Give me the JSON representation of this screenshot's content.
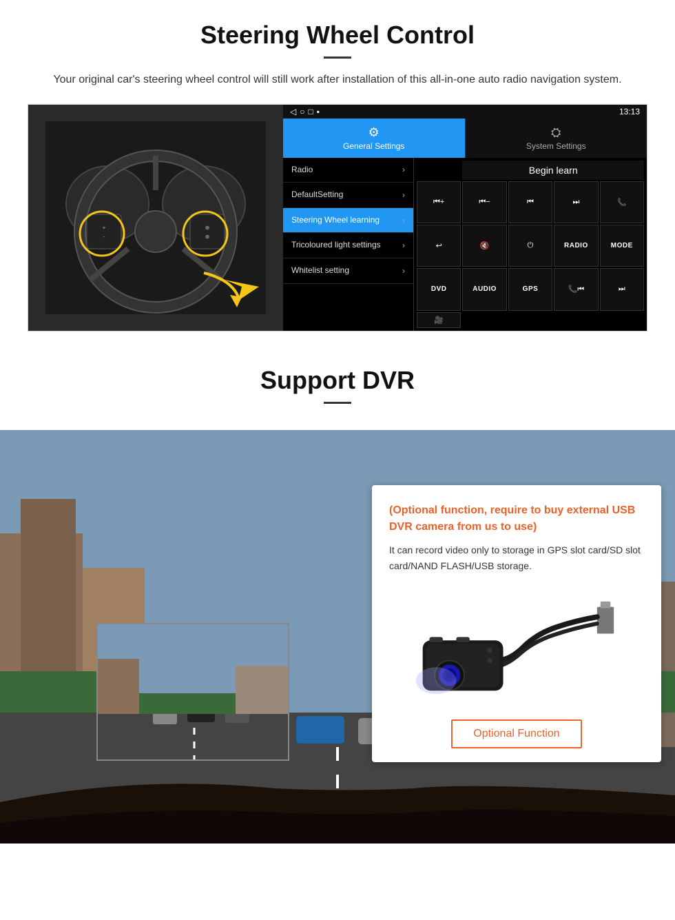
{
  "section1": {
    "title": "Steering Wheel Control",
    "description": "Your original car's steering wheel control will still work after installation of this all-in-one auto radio navigation system.",
    "statusbar": {
      "time": "13:13",
      "icons": "▼ ▼"
    },
    "tabs": {
      "active": {
        "icon": "⚙",
        "label": "General Settings"
      },
      "inactive": {
        "icon": "🔧",
        "label": "System Settings"
      }
    },
    "menu_items": [
      {
        "label": "Radio",
        "active": false
      },
      {
        "label": "DefaultSetting",
        "active": false
      },
      {
        "label": "Steering Wheel learning",
        "active": true
      },
      {
        "label": "Tricoloured light settings",
        "active": false
      },
      {
        "label": "Whitelist setting",
        "active": false
      }
    ],
    "begin_learn": "Begin learn",
    "control_buttons": [
      "⏮+",
      "⏮−",
      "⏮",
      "⏭",
      "📞",
      "↩",
      "🔇",
      "⏻",
      "RADIO",
      "MODE",
      "DVD",
      "AUDIO",
      "GPS",
      "📞⏮",
      "⏭"
    ]
  },
  "section2": {
    "title": "Support DVR",
    "divider": true,
    "info_card": {
      "optional_text": "(Optional function, require to buy external USB DVR camera from us to use)",
      "description": "It can record video only to storage in GPS slot card/SD slot card/NAND FLASH/USB storage.",
      "optional_button_label": "Optional Function"
    }
  }
}
